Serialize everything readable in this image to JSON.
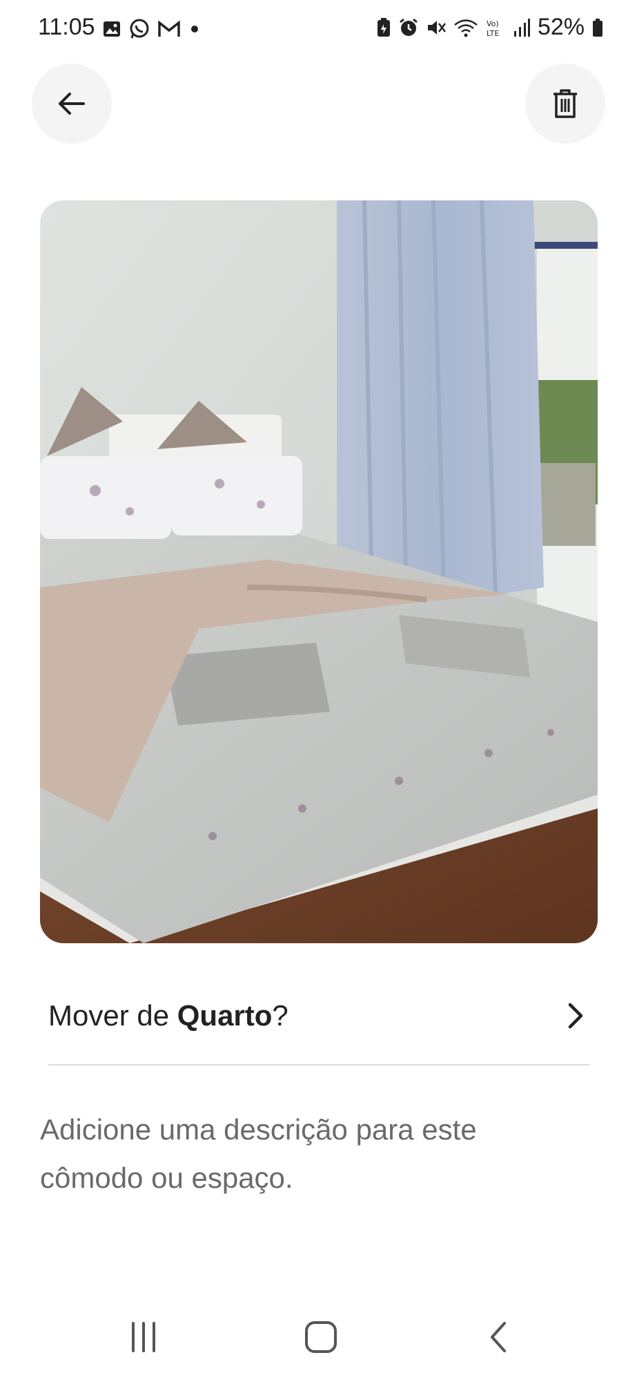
{
  "status_bar": {
    "time": "11:05",
    "battery": "52%",
    "left_icons": [
      "gallery-icon",
      "whatsapp-icon",
      "gmail-icon",
      "dot-icon"
    ],
    "right_icons": [
      "battery-saver-icon",
      "alarm-icon",
      "mute-icon",
      "wifi-icon",
      "volte-icon",
      "signal-icon",
      "battery-icon"
    ]
  },
  "header": {
    "back_icon": "arrow-left-icon",
    "delete_icon": "trash-icon"
  },
  "photo": {
    "subject": "bedroom"
  },
  "move_row": {
    "prefix": "Mover de ",
    "room": "Quarto",
    "suffix": "?",
    "icon": "chevron-right-icon"
  },
  "description": {
    "placeholder": "Adicione uma descrição para este cômodo ou espaço."
  },
  "nav_bar": {
    "icons": [
      "recent-apps-icon",
      "home-icon",
      "back-icon"
    ]
  },
  "colors": {
    "text": "#222222",
    "muted": "#6a6a6a",
    "button_bg": "#f4f4f4",
    "divider": "#dddddd"
  }
}
